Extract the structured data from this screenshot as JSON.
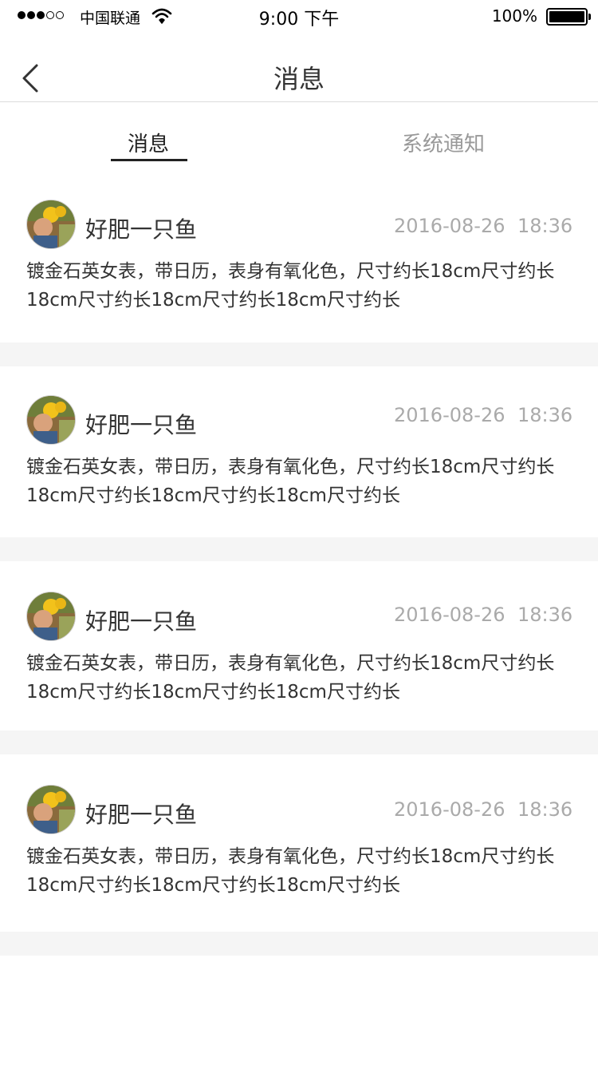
{
  "status_bar": {
    "signal_dots": [
      1,
      1,
      1,
      0,
      0
    ],
    "carrier": "中国联通",
    "time": "9:00 下午",
    "battery_percent": "100%",
    "battery_level": 1.0
  },
  "nav": {
    "back_icon": "chevron-left-icon",
    "title": "消息"
  },
  "tabs": [
    {
      "label": "消息",
      "active": true
    },
    {
      "label": "系统通知",
      "active": false
    }
  ],
  "messages": [
    {
      "sender": "好肥一只鱼",
      "date": "2016-08-26",
      "time": "18:36",
      "content": "镀金石英女表，带日历，表身有氧化色，尺寸约长18cm尺寸约长18cm尺寸约长18cm尺寸约长18cm尺寸约长"
    },
    {
      "sender": "好肥一只鱼",
      "date": "2016-08-26",
      "time": "18:36",
      "content": "镀金石英女表，带日历，表身有氧化色，尺寸约长18cm尺寸约长18cm尺寸约长18cm尺寸约长18cm尺寸约长"
    },
    {
      "sender": "好肥一只鱼",
      "date": "2016-08-26",
      "time": "18:36",
      "content": "镀金石英女表，带日历，表身有氧化色，尺寸约长18cm尺寸约长18cm尺寸约长18cm尺寸约长18cm尺寸约长"
    },
    {
      "sender": "好肥一只鱼",
      "date": "2016-08-26",
      "time": "18:36",
      "content": "镀金石英女表，带日历，表身有氧化色，尺寸约长18cm尺寸约长18cm尺寸约长18cm尺寸约长18cm尺寸约长"
    }
  ],
  "colors": {
    "text_primary": "#333333",
    "text_secondary": "#aaaaaa",
    "tab_inactive": "#999999",
    "divider": "#f5f5f5"
  }
}
